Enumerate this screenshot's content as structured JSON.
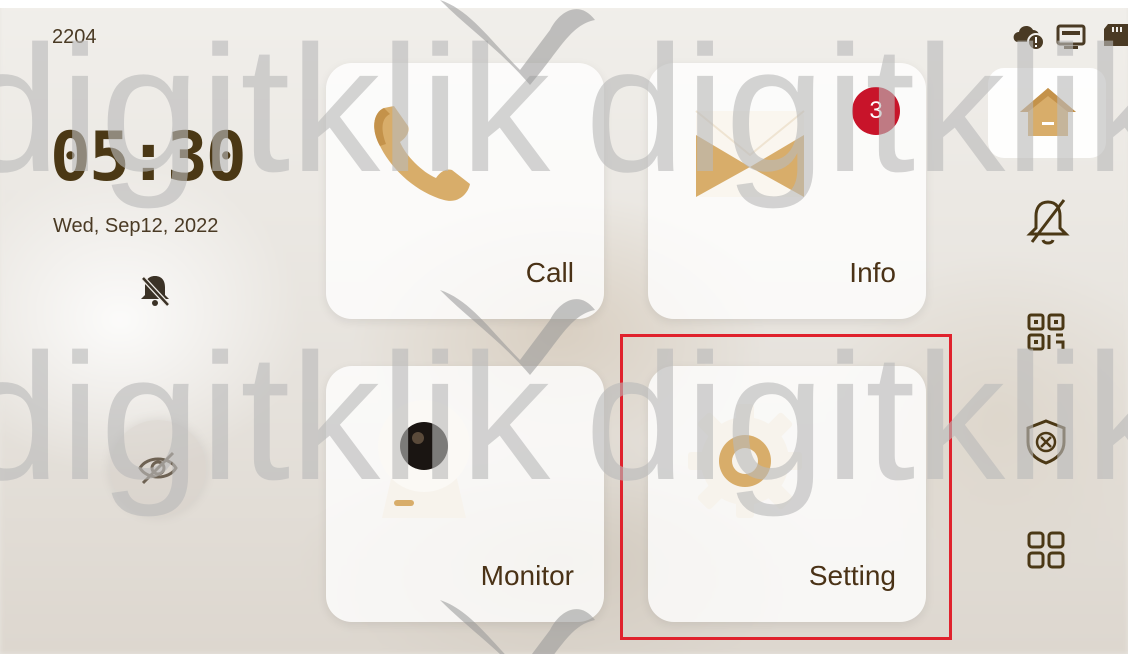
{
  "status": {
    "room_number": "2204",
    "icons": [
      "cloud-alert-icon",
      "screen-icon",
      "sd-card-icon"
    ]
  },
  "clock": {
    "time": "05:30",
    "date": "Wed, Sep12, 2022"
  },
  "tiles": {
    "call": {
      "label": "Call",
      "icon": "phone-icon"
    },
    "info": {
      "label": "Info",
      "icon": "envelope-icon",
      "badge": "3"
    },
    "monitor": {
      "label": "Monitor",
      "icon": "camera-icon"
    },
    "setting": {
      "label": "Setting",
      "icon": "gear-icon"
    }
  },
  "sidebar": {
    "items": [
      {
        "name": "home",
        "icon": "home-icon"
      },
      {
        "name": "do-not-disturb",
        "icon": "bell-off-icon"
      },
      {
        "name": "qr-code",
        "icon": "qr-code-icon"
      },
      {
        "name": "security",
        "icon": "shield-x-icon"
      },
      {
        "name": "apps",
        "icon": "apps-grid-icon"
      }
    ]
  },
  "watermark": "digitklik",
  "colors": {
    "accent": "#4b3815",
    "badge": "#c8142a",
    "highlight": "#e0222d",
    "gold": "#d4a864"
  }
}
